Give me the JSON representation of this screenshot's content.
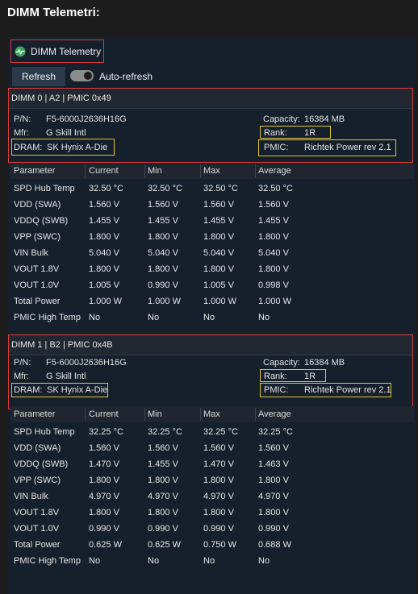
{
  "page_title": "DIMM Telemetri:",
  "tab": {
    "label": "DIMM Telemetry",
    "icon": "heartbeat-icon"
  },
  "toolbar": {
    "refresh_label": "Refresh",
    "auto_refresh_label": "Auto-refresh",
    "auto_refresh_on": true
  },
  "labels": {
    "pn": "P/N:",
    "mfr": "Mfr:",
    "dram": "DRAM:",
    "capacity": "Capacity:",
    "rank": "Rank:",
    "pmic": "PMIC:"
  },
  "columns": [
    "Parameter",
    "Current",
    "Min",
    "Max",
    "Average"
  ],
  "dimms": [
    {
      "header": "DIMM 0 | A2 | PMIC 0x49",
      "pn": "F5-6000J2636H16G",
      "mfr": "G Skill Intl",
      "dram": "SK Hynix A-Die",
      "capacity": "16384 MB",
      "rank": "1R",
      "pmic": "Richtek Power rev 2.1",
      "rows": [
        [
          "SPD Hub Temp",
          "32.50 °C",
          "32.50 °C",
          "32.50 °C",
          "32.50 °C"
        ],
        [
          "VDD (SWA)",
          "1.560 V",
          "1.560 V",
          "1.560 V",
          "1.560 V"
        ],
        [
          "VDDQ (SWB)",
          "1.455 V",
          "1.455 V",
          "1.455 V",
          "1.455 V"
        ],
        [
          "VPP (SWC)",
          "1.800 V",
          "1.800 V",
          "1.800 V",
          "1.800 V"
        ],
        [
          "VIN Bulk",
          "5.040 V",
          "5.040 V",
          "5.040 V",
          "5.040 V"
        ],
        [
          "VOUT 1.8V",
          "1.800 V",
          "1.800 V",
          "1.800 V",
          "1.800 V"
        ],
        [
          "VOUT 1.0V",
          "1.005 V",
          "0.990 V",
          "1.005 V",
          "0.998 V"
        ],
        [
          "Total Power",
          "1.000 W",
          "1.000 W",
          "1.000 W",
          "1.000 W"
        ],
        [
          "PMIC High Temp",
          "No",
          "No",
          "No",
          "No"
        ]
      ]
    },
    {
      "header": "DIMM 1 | B2 | PMIC 0x4B",
      "pn": "F5-6000J2636H16G",
      "mfr": "G Skill Intl",
      "dram": "SK Hynix A-Die",
      "capacity": "16384 MB",
      "rank": "1R",
      "pmic": "Richtek Power rev 2.1",
      "rows": [
        [
          "SPD Hub Temp",
          "32.25 °C",
          "32.25 °C",
          "32.25 °C",
          "32.25 °C"
        ],
        [
          "VDD (SWA)",
          "1.560 V",
          "1.560 V",
          "1.560 V",
          "1.560 V"
        ],
        [
          "VDDQ (SWB)",
          "1.470 V",
          "1.455 V",
          "1.470 V",
          "1.463 V"
        ],
        [
          "VPP (SWC)",
          "1.800 V",
          "1.800 V",
          "1.800 V",
          "1.800 V"
        ],
        [
          "VIN Bulk",
          "4.970 V",
          "4.970 V",
          "4.970 V",
          "4.970 V"
        ],
        [
          "VOUT 1.8V",
          "1.800 V",
          "1.800 V",
          "1.800 V",
          "1.800 V"
        ],
        [
          "VOUT 1.0V",
          "0.990 V",
          "0.990 V",
          "0.990 V",
          "0.990 V"
        ],
        [
          "Total Power",
          "0.625 W",
          "0.625 W",
          "0.750 W",
          "0.688 W"
        ],
        [
          "PMIC High Temp",
          "No",
          "No",
          "No",
          "No"
        ]
      ]
    }
  ]
}
